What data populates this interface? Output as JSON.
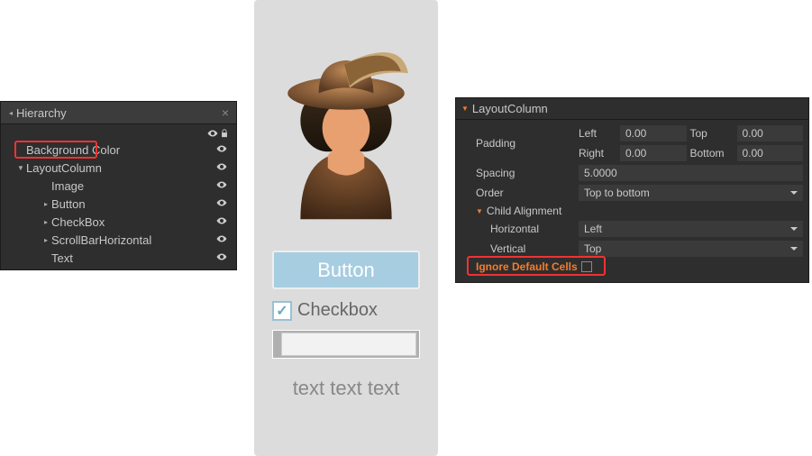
{
  "hierarchy": {
    "title": "Hierarchy",
    "items": [
      {
        "label": "Background Color",
        "indent": 16,
        "arrow": ""
      },
      {
        "label": "LayoutColumn",
        "indent": 16,
        "arrow": "▼",
        "highlighted": true
      },
      {
        "label": "Image",
        "indent": 44,
        "arrow": ""
      },
      {
        "label": "Button",
        "indent": 44,
        "arrow": "▸"
      },
      {
        "label": "CheckBox",
        "indent": 44,
        "arrow": "▸"
      },
      {
        "label": "ScrollBarHorizontal",
        "indent": 44,
        "arrow": "▸"
      },
      {
        "label": "Text",
        "indent": 44,
        "arrow": ""
      }
    ]
  },
  "preview": {
    "button_label": "Button",
    "checkbox_label": "Checkbox",
    "checkbox_checked": true,
    "text": "text text text"
  },
  "properties": {
    "title": "LayoutColumn",
    "padding_label": "Padding",
    "padding": {
      "left_label": "Left",
      "left": "0.00",
      "top_label": "Top",
      "top": "0.00",
      "right_label": "Right",
      "right": "0.00",
      "bottom_label": "Bottom",
      "bottom": "0.00"
    },
    "spacing_label": "Spacing",
    "spacing": "5.0000",
    "order_label": "Order",
    "order": "Top to bottom",
    "child_alignment_label": "Child Alignment",
    "horizontal_label": "Horizontal",
    "horizontal": "Left",
    "vertical_label": "Vertical",
    "vertical": "Top",
    "ignore_default_cells_label": "Ignore Default Cells",
    "ignore_default_cells_checked": false
  }
}
